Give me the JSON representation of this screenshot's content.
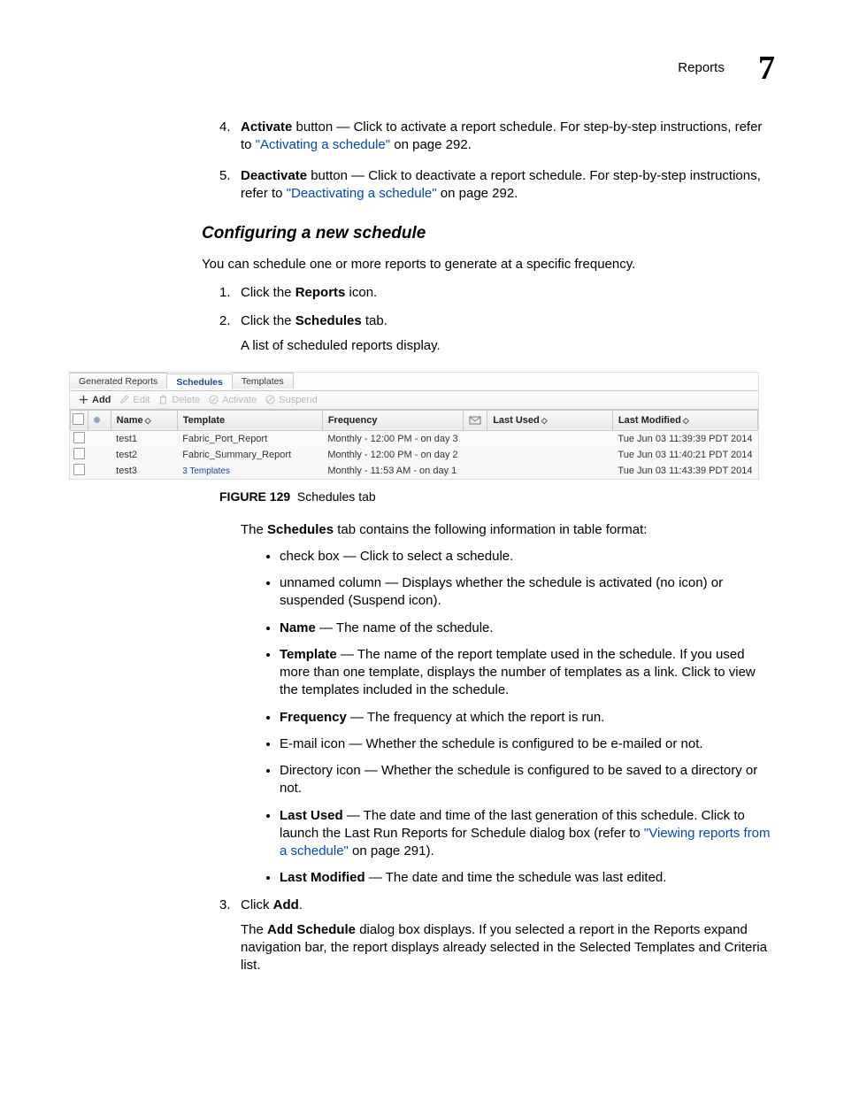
{
  "header": {
    "section_title": "Reports",
    "chapter_number": "7"
  },
  "ol_top": [
    {
      "num": "4.",
      "term": "Activate",
      "post_term": " button — Click to activate a report schedule. For step-by-step instructions, refer to ",
      "link": "\"Activating a schedule\"",
      "tail": " on page 292."
    },
    {
      "num": "5.",
      "term": "Deactivate",
      "post_term": " button — Click to deactivate a report schedule. For step-by-step instructions, refer to ",
      "link": "\"Deactivating a schedule\"",
      "tail": " on page 292."
    }
  ],
  "heading_configuring": "Configuring a new schedule",
  "intro_p": "You can schedule one or more reports to generate at a specific frequency.",
  "steps": {
    "s1_pre": "Click the ",
    "s1_bold": "Reports",
    "s1_post": " icon.",
    "s2_pre": "Click the ",
    "s2_bold": "Schedules",
    "s2_post": " tab.",
    "s2_sub": "A list of scheduled reports display.",
    "fig_caption_label": "FIGURE 129",
    "fig_caption_text": "Schedules tab",
    "tab_intro_pre": "The ",
    "tab_intro_bold": "Schedules",
    "tab_intro_post": " tab contains the following information in table format:",
    "bullets": {
      "b1": "check box — Click to select a schedule.",
      "b2": "unnamed column — Displays whether the schedule is activated (no icon) or suspended (Suspend icon).",
      "b3_term": "Name",
      "b3_post": " — The name of the schedule.",
      "b4_term": "Template",
      "b4_post": " — The name of the report template used in the schedule. If you used more than one template, displays the number of templates as a link. Click to view the templates included in the schedule.",
      "b5_term": "Frequency",
      "b5_post": " — The frequency at which the report is run.",
      "b6": "E-mail icon — Whether the schedule is configured to be e-mailed or not.",
      "b7": "Directory icon — Whether the schedule is configured to be saved to a directory or not.",
      "b8_term": "Last Used",
      "b8_post": " — The date and time of the last generation of this schedule. Click to launch the Last Run Reports for Schedule dialog box (refer to ",
      "b8_link": "\"Viewing reports from a schedule\"",
      "b8_tail": " on page 291).",
      "b9_term": "Last Modified",
      "b9_post": " — The date and time the schedule was last edited."
    },
    "s3_pre": "Click ",
    "s3_bold": "Add",
    "s3_post": ".",
    "s3_sub_pre": "The ",
    "s3_sub_bold": "Add Schedule",
    "s3_sub_post": " dialog box displays. If you selected a report in the Reports expand navigation bar, the report displays already selected in the Selected Templates and Criteria list."
  },
  "figure": {
    "tabs": {
      "generated": "Generated Reports",
      "schedules": "Schedules",
      "templates": "Templates"
    },
    "toolbar": {
      "add": "Add",
      "edit": "Edit",
      "delete": "Delete",
      "activate": "Activate",
      "suspend": "Suspend"
    },
    "columns": {
      "name": "Name",
      "template": "Template",
      "frequency": "Frequency",
      "lastused": "Last Used",
      "lastmodified": "Last Modified"
    },
    "rows": [
      {
        "name": "test1",
        "template": "Fabric_Port_Report",
        "template_is_link": false,
        "frequency": "Monthly - 12:00 PM - on day 3",
        "lastused": "",
        "lastmodified": "Tue Jun 03 11:39:39 PDT 2014"
      },
      {
        "name": "test2",
        "template": "Fabric_Summary_Report",
        "template_is_link": false,
        "frequency": "Monthly - 12:00 PM - on day 2",
        "lastused": "",
        "lastmodified": "Tue Jun 03 11:40:21 PDT 2014"
      },
      {
        "name": "test3",
        "template": "3 Templates",
        "template_is_link": true,
        "frequency": "Monthly - 11:53 AM - on day 1",
        "lastused": "",
        "lastmodified": "Tue Jun 03 11:43:39 PDT 2014"
      }
    ],
    "sort_glyph": "◇"
  }
}
